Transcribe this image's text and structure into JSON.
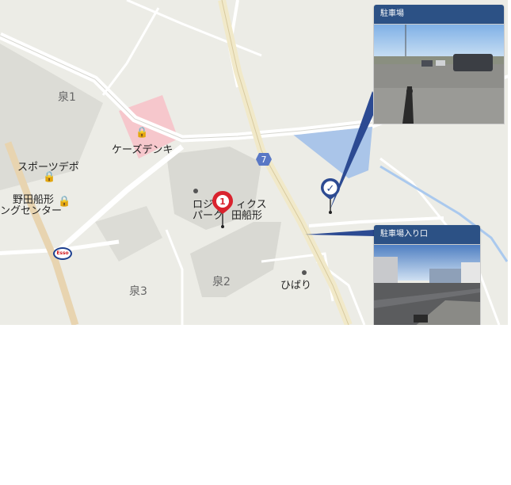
{
  "map": {
    "areas": [
      "泉1",
      "泉2",
      "泉3"
    ],
    "places": {
      "ks_denki": "ケーズデンキ",
      "sports_depo": "スポーツデポ",
      "noda_center_1": "野田船形",
      "noda_center_2": "ングセンター",
      "logistics_1": "ロジ",
      "logistics_1b": "ィクス",
      "logistics_2": "パーク",
      "logistics_2b": "田船形",
      "hibari": "ひばり"
    },
    "route_number": "7",
    "esso_label": "Esso",
    "marker_number": "1",
    "checkmark": "✓"
  },
  "popups": {
    "parking": {
      "title": "駐車場"
    },
    "parking_entrance": {
      "title": "駐車場入り口"
    }
  },
  "colors": {
    "popup_header": "#2c5185",
    "marker_red": "#d9232e",
    "marker_blue": "#2c4a92",
    "parking_area": "#a9c4e8",
    "river": "#a9c9ef",
    "map_bg": "#ededE7"
  }
}
